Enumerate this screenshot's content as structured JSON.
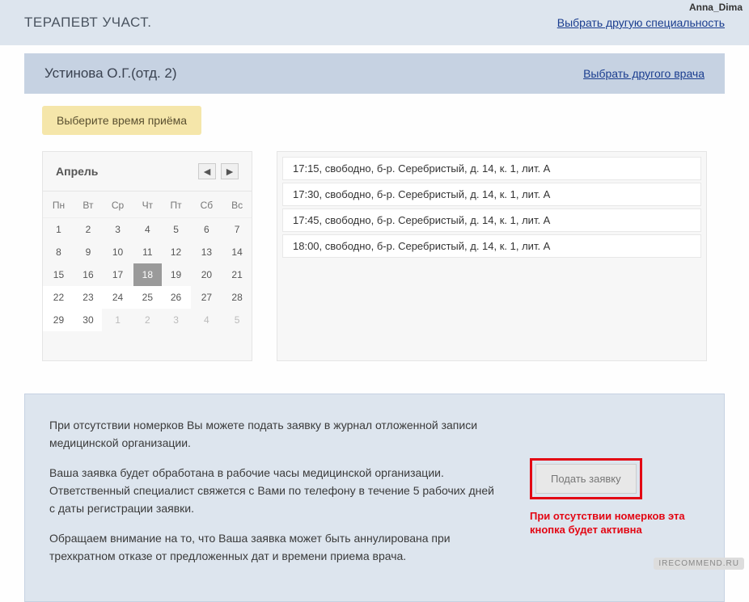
{
  "watermark_top": "Anna_Dima",
  "watermark_bottom": "IRECOMMEND.RU",
  "header": {
    "specialty": "ТЕРАПЕВТ УЧАСТ.",
    "change_specialty": "Выбрать другую специальность"
  },
  "doctor": {
    "name": "Устинова О.Г.(отд. 2)",
    "change_doctor": "Выбрать другого врача"
  },
  "badge": "Выберите время приёма",
  "calendar": {
    "month": "Апрель",
    "weekdays": [
      "Пн",
      "Вт",
      "Ср",
      "Чт",
      "Пт",
      "Сб",
      "Вс"
    ],
    "selected": 18,
    "rows": [
      {
        "cells": [
          {
            "d": 1
          },
          {
            "d": 2
          },
          {
            "d": 3
          },
          {
            "d": 4
          },
          {
            "d": 5
          },
          {
            "d": 6
          },
          {
            "d": 7
          }
        ]
      },
      {
        "cells": [
          {
            "d": 8
          },
          {
            "d": 9
          },
          {
            "d": 10
          },
          {
            "d": 11
          },
          {
            "d": 12
          },
          {
            "d": 13
          },
          {
            "d": 14
          }
        ]
      },
      {
        "cells": [
          {
            "d": 15
          },
          {
            "d": 16
          },
          {
            "d": 17
          },
          {
            "d": 18,
            "sel": true
          },
          {
            "d": 19
          },
          {
            "d": 20
          },
          {
            "d": 21
          }
        ]
      },
      {
        "cells": [
          {
            "d": 22,
            "a": true
          },
          {
            "d": 23,
            "a": true
          },
          {
            "d": 24,
            "a": true
          },
          {
            "d": 25,
            "a": true
          },
          {
            "d": 26,
            "a": true
          },
          {
            "d": 27
          },
          {
            "d": 28
          }
        ]
      },
      {
        "cells": [
          {
            "d": 29,
            "a": true
          },
          {
            "d": 30,
            "a": true
          },
          {
            "d": 1,
            "dim": true
          },
          {
            "d": 2,
            "dim": true
          },
          {
            "d": 3,
            "dim": true
          },
          {
            "d": 4,
            "dim": true
          },
          {
            "d": 5,
            "dim": true
          }
        ]
      }
    ]
  },
  "slots": [
    "17:15, свободно, б-р. Серебристый, д. 14, к. 1, лит. А",
    "17:30, свободно, б-р. Серебристый, д. 14, к. 1, лит. А",
    "17:45, свободно, б-р. Серебристый, д. 14, к. 1, лит. А",
    "18:00, свободно, б-р. Серебристый, д. 14, к. 1, лит. А"
  ],
  "info": {
    "p1": "При отсутствии номерков Вы можете подать заявку в журнал отложенной записи медицинской организации.",
    "p2": "Ваша заявка будет обработана в рабочие часы медицинской организации. Ответственный специалист свяжется с Вами по телефону в течение 5 рабочих дней с даты регистрации заявки.",
    "p3": "Обращаем внимание на то, что Ваша заявка может быть аннулирована при трехкратном отказе от предложенных дат и времени приема врача.",
    "submit": "Подать заявку",
    "red_note": "При отсутствии номерков эта кнопка будет активна"
  }
}
